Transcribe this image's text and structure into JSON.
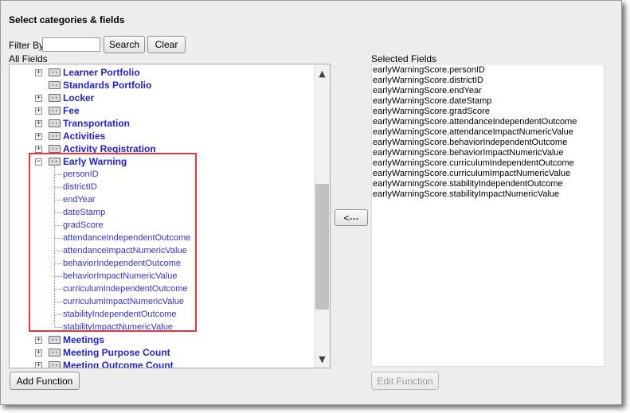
{
  "title": "Select categories & fields",
  "filter": {
    "label": "Filter By",
    "value": "",
    "placeholder": "",
    "search_label": "Search",
    "clear_label": "Clear"
  },
  "all_fields": {
    "label": "All Fields",
    "categories_before": [
      {
        "label": "Learner Portfolio",
        "expandable": true
      },
      {
        "label": "Standards Portfolio",
        "expandable": false
      },
      {
        "label": "Locker",
        "expandable": true
      },
      {
        "label": "Fee",
        "expandable": true
      },
      {
        "label": "Transportation",
        "expandable": true
      },
      {
        "label": "Activities",
        "expandable": true
      },
      {
        "label": "Activity Registration",
        "expandable": true
      }
    ],
    "expanded_category": {
      "label": "Early Warning",
      "fields": [
        "personID",
        "districtID",
        "endYear",
        "dateStamp",
        "gradScore",
        "attendanceIndependentOutcome",
        "attendanceImpactNumericValue",
        "behaviorIndependentOutcome",
        "behaviorImpactNumericValue",
        "curriculumIndependentOutcome",
        "curriculumImpactNumericValue",
        "stabilityIndependentOutcome",
        "stabilityImpactNumericValue"
      ]
    },
    "categories_after": [
      {
        "label": "Meetings",
        "expandable": true
      },
      {
        "label": "Meeting Purpose Count",
        "expandable": true
      },
      {
        "label": "Meeting Outcome Count",
        "expandable": true
      }
    ]
  },
  "move_button_label": "<---",
  "selected_fields": {
    "label": "Selected Fields",
    "items": [
      "earlyWarningScore.personID",
      "earlyWarningScore.districtID",
      "earlyWarningScore.endYear",
      "earlyWarningScore.dateStamp",
      "earlyWarningScore.gradScore",
      "earlyWarningScore.attendanceIndependentOutcome",
      "earlyWarningScore.attendanceImpactNumericValue",
      "earlyWarningScore.behaviorIndependentOutcome",
      "earlyWarningScore.behaviorImpactNumericValue",
      "earlyWarningScore.curriculumIndependentOutcome",
      "earlyWarningScore.curriculumImpactNumericValue",
      "earlyWarningScore.stabilityIndependentOutcome",
      "earlyWarningScore.stabilityImpactNumericValue"
    ]
  },
  "add_function_label": "Add Function",
  "edit_function_label": "Edit Function",
  "icons": {
    "expand": "plus-expander-icon",
    "collapse": "minus-expander-icon",
    "node": "category-node-icon",
    "scroll_up": "chevron-up-icon",
    "scroll_down": "chevron-down-icon"
  },
  "colors": {
    "tree_link": "#2222c8",
    "highlight": "#e5393e"
  }
}
